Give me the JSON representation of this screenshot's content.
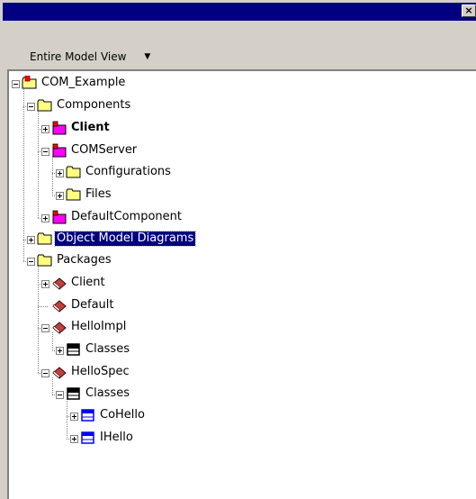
{
  "toolbar": {
    "view_label": "Entire Model View"
  },
  "tree": {
    "root": "COM_Example",
    "components": "Components",
    "client_component": "Client",
    "comserver": "COMServer",
    "configurations": "Configurations",
    "files": "Files",
    "default_component": "DefaultComponent",
    "object_model_diagrams": "Object Model Diagrams",
    "packages": "Packages",
    "client_package": "Client",
    "default_package": "Default",
    "helloimpl": "HelloImpl",
    "helloimpl_classes": "Classes",
    "hellospec": "HelloSpec",
    "hellospec_classes": "Classes",
    "cohello": "CoHello",
    "ihello": "IHello"
  },
  "colors": {
    "title_bar": "#000080",
    "folder": "#ffff80",
    "component": "#ff00ff",
    "package": "#c04040",
    "class_icon": "#0000ff",
    "selection": "#000080"
  }
}
